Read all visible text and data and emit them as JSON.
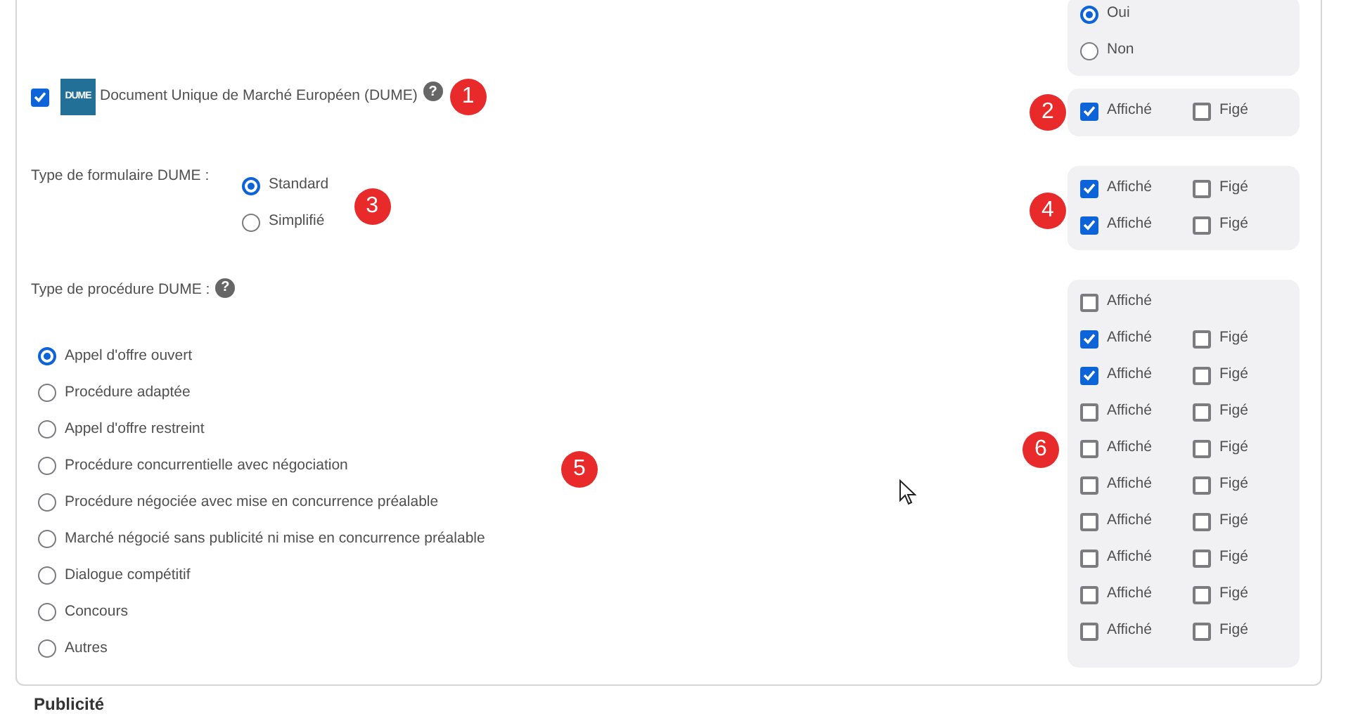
{
  "top_panel": {
    "options": [
      {
        "label": "Oui",
        "selected": true
      },
      {
        "label": "Non",
        "selected": false
      }
    ]
  },
  "dume": {
    "checked": true,
    "logo": "DUME",
    "label": "Document Unique de Marché Européen (DUME)",
    "help": "?",
    "marker": "1",
    "panel_marker": "2",
    "panel": [
      {
        "shown": {
          "label": "Affiché",
          "checked": true
        },
        "frozen": {
          "label": "Figé",
          "checked": false
        }
      }
    ]
  },
  "form_type": {
    "label": "Type de formulaire DUME :",
    "marker": "3",
    "options": [
      {
        "label": "Standard",
        "selected": true
      },
      {
        "label": "Simplifié",
        "selected": false
      }
    ],
    "panel_marker": "4",
    "panel": [
      {
        "shown": {
          "label": "Affiché",
          "checked": true
        },
        "frozen": {
          "label": "Figé",
          "checked": false
        }
      },
      {
        "shown": {
          "label": "Affiché",
          "checked": true
        },
        "frozen": {
          "label": "Figé",
          "checked": false
        }
      }
    ]
  },
  "procedure_type": {
    "label": "Type de procédure DUME :",
    "help": "?",
    "marker": "5",
    "options": [
      {
        "label": "Appel d'offre ouvert",
        "selected": true
      },
      {
        "label": "Procédure adaptée",
        "selected": false
      },
      {
        "label": "Appel d'offre restreint",
        "selected": false
      },
      {
        "label": "Procédure concurrentielle avec négociation",
        "selected": false
      },
      {
        "label": "Procédure négociée avec mise en concurrence préalable",
        "selected": false
      },
      {
        "label": "Marché négocié sans publicité ni mise en concurrence préalable",
        "selected": false
      },
      {
        "label": "Dialogue compétitif",
        "selected": false
      },
      {
        "label": "Concours",
        "selected": false
      },
      {
        "label": "Autres",
        "selected": false
      }
    ],
    "panel_marker": "6",
    "panel": [
      {
        "shown": {
          "label": "Affiché",
          "checked": false
        }
      },
      {
        "shown": {
          "label": "Affiché",
          "checked": true
        },
        "frozen": {
          "label": "Figé",
          "checked": false
        }
      },
      {
        "shown": {
          "label": "Affiché",
          "checked": true
        },
        "frozen": {
          "label": "Figé",
          "checked": false
        }
      },
      {
        "shown": {
          "label": "Affiché",
          "checked": false
        },
        "frozen": {
          "label": "Figé",
          "checked": false
        }
      },
      {
        "shown": {
          "label": "Affiché",
          "checked": false
        },
        "frozen": {
          "label": "Figé",
          "checked": false
        }
      },
      {
        "shown": {
          "label": "Affiché",
          "checked": false
        },
        "frozen": {
          "label": "Figé",
          "checked": false
        }
      },
      {
        "shown": {
          "label": "Affiché",
          "checked": false
        },
        "frozen": {
          "label": "Figé",
          "checked": false
        }
      },
      {
        "shown": {
          "label": "Affiché",
          "checked": false
        },
        "frozen": {
          "label": "Figé",
          "checked": false
        }
      },
      {
        "shown": {
          "label": "Affiché",
          "checked": false
        },
        "frozen": {
          "label": "Figé",
          "checked": false
        }
      },
      {
        "shown": {
          "label": "Affiché",
          "checked": false
        },
        "frozen": {
          "label": "Figé",
          "checked": false
        }
      }
    ]
  },
  "next_section": {
    "title": "Publicité"
  }
}
